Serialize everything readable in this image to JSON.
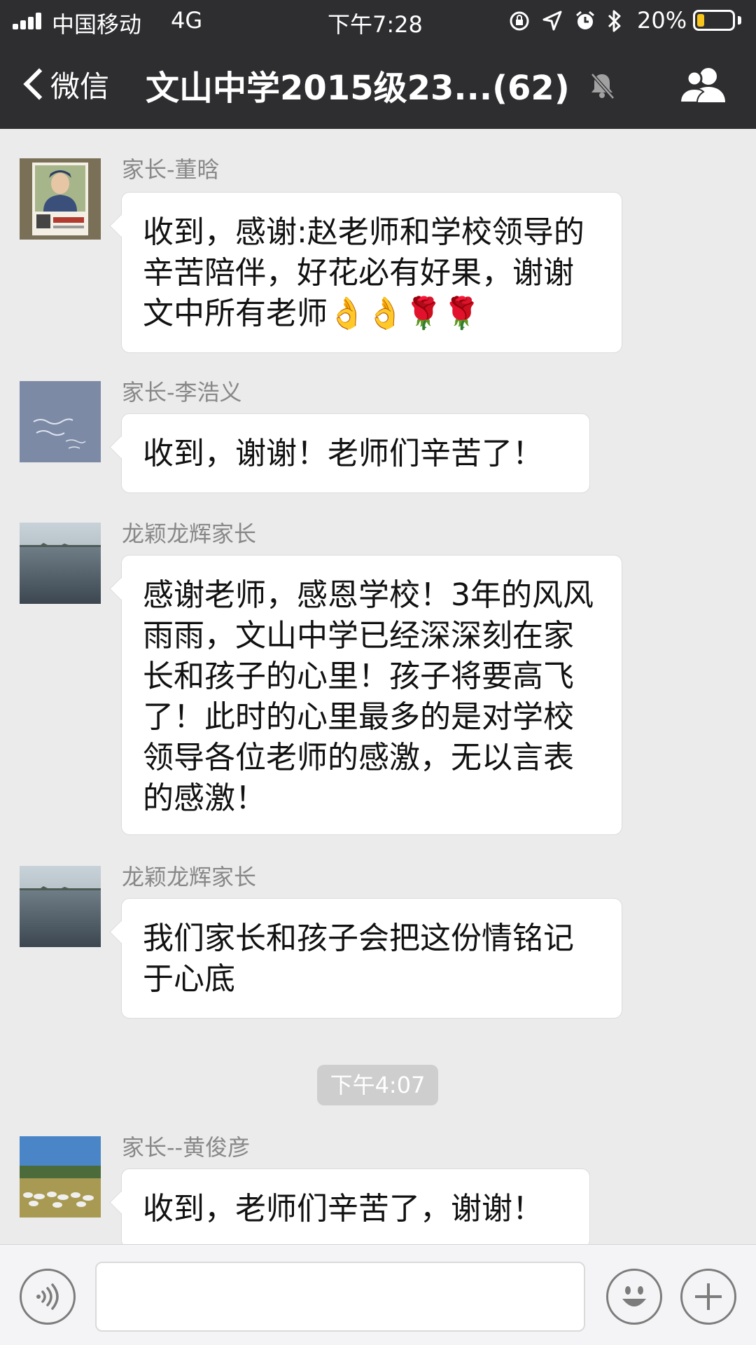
{
  "status_bar": {
    "carrier": "中国移动",
    "network": "4G",
    "time": "下午7:28",
    "battery_percent": "20%",
    "battery_level": 0.2,
    "battery_color": "#f7c51c",
    "icons": [
      "orientation-lock-icon",
      "location-arrow-icon",
      "alarm-icon",
      "bluetooth-icon"
    ]
  },
  "nav": {
    "back_label": "微信",
    "title": "文山中学2015级23...(62)",
    "muted": true,
    "right_icon": "group-members-icon"
  },
  "messages": [
    {
      "sender": "家长-董晗",
      "text": "收到，感谢:赵老师和学校领导的辛苦陪伴，好花必有好果，谢谢文中所有老师👌👌🌹🌹",
      "avatar": "avatar-uniform-portrait"
    },
    {
      "sender": "家长-李浩义",
      "text": "收到，谢谢！老师们辛苦了！",
      "avatar": "avatar-handwriting-note"
    },
    {
      "sender": "龙颖龙辉家长",
      "text": "感谢老师，感恩学校！3年的风风雨雨，文山中学已经深深刻在家长和孩子的心里！孩子将要高飞了！此时的心里最多的是对学校领导各位老师的感激，无以言表的感激！",
      "avatar": "avatar-lake"
    },
    {
      "sender": "龙颖龙辉家长",
      "text": "我们家长和孩子会把这份情铭记于心底",
      "avatar": "avatar-lake"
    },
    {
      "sender": "家长--黄俊彦",
      "text": "收到，老师们辛苦了，谢谢！",
      "avatar": "avatar-grassland-sheep"
    }
  ],
  "timestamp_divider": "下午4:07",
  "input_bar": {
    "voice_icon": "voice-icon",
    "message_value": "",
    "emoji_icon": "emoji-icon",
    "plus_icon": "plus-icon"
  },
  "colors": {
    "header_bg": "#2e2e31",
    "chat_bg": "#ebebeb",
    "bubble_bg": "#ffffff",
    "sender_text": "#888888",
    "time_pill_bg": "#cecece"
  }
}
